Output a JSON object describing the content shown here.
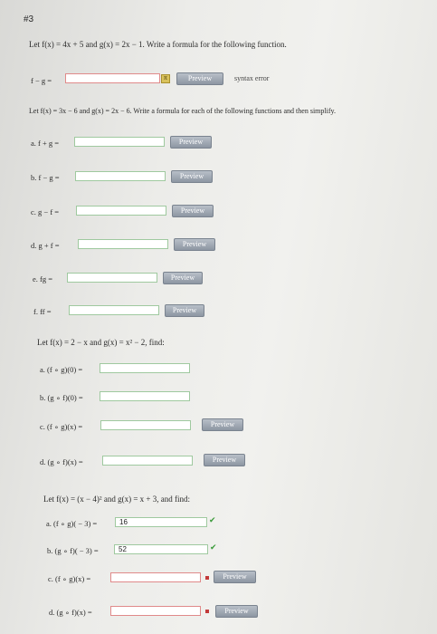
{
  "problem_number": "#3",
  "part1": {
    "statement": "Let f(x) = 4x + 5 and g(x) = 2x − 1. Write a formula for the following function.",
    "question": "f − g =",
    "preview_label": "Preview",
    "error_text": "syntax error",
    "pi_icon": "π"
  },
  "part2": {
    "statement": "Let f(x) = 3x − 6 and g(x) = 2x − 6. Write a formula for each of the following functions and then simplify.",
    "items": [
      {
        "label": "a. f + g =",
        "preview": "Preview"
      },
      {
        "label": "b. f − g =",
        "preview": "Preview"
      },
      {
        "label": "c. g − f =",
        "preview": "Preview"
      },
      {
        "label": "d. g + f =",
        "preview": "Preview"
      },
      {
        "label": "e. fg =",
        "preview": "Preview"
      },
      {
        "label": "f. ff =",
        "preview": "Preview"
      }
    ]
  },
  "part3": {
    "statement": "Let f(x) = 2 − x and g(x) = x² − 2, find:",
    "items": [
      {
        "label": "a. (f ∘ g)(0) ="
      },
      {
        "label": "b. (g ∘ f)(0) ="
      },
      {
        "label": "c. (f ∘ g)(x) =",
        "preview": "Preview"
      },
      {
        "label": "d. (g ∘ f)(x) =",
        "preview": "Preview"
      }
    ]
  },
  "part4": {
    "statement": "Let f(x) = (x − 4)² and g(x) = x + 3, and find:",
    "items": [
      {
        "label": "a. (f ∘ g)( − 3) =",
        "value": "16",
        "status": "correct"
      },
      {
        "label": "b. (g ∘ f)( − 3) =",
        "value": "52",
        "status": "correct"
      },
      {
        "label": "c. (f ∘ g)(x) =",
        "preview": "Preview",
        "status": "incorrect"
      },
      {
        "label": "d. (g ∘ f)(x) =",
        "preview": "Preview",
        "status": "incorrect"
      }
    ]
  },
  "colors": {
    "input_border_ok": "#9fc99f",
    "input_border_error": "#e08a8a",
    "check": "#3a9a3a",
    "wrong_marker": "#c23a3a"
  }
}
